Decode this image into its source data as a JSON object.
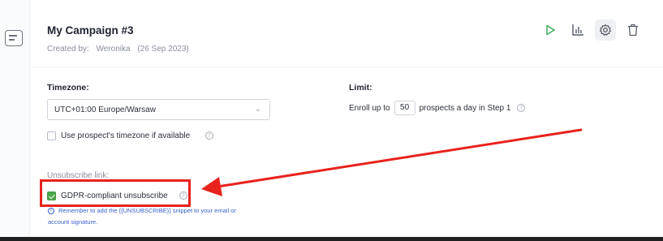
{
  "campaign": {
    "title": "My Campaign #3",
    "created_by_label": "Created by:",
    "created_by": "Weronika",
    "created_date": "(26 Sep 2023)"
  },
  "toolbar": {
    "icons": [
      "play-icon",
      "stats-icon",
      "settings-icon",
      "trash-icon"
    ],
    "accent_color": "#3fae5f"
  },
  "timezone": {
    "label": "Timezone:",
    "selected": "UTC+01:00 Europe/Warsaw",
    "use_prospect_label": "Use prospect's timezone if available",
    "use_prospect_checked": false
  },
  "limit": {
    "label": "Limit:",
    "prefix": "Enroll up to",
    "value": "50",
    "suffix": "prospects a day in Step 1"
  },
  "unsubscribe": {
    "label": "Unsubscribe link:",
    "gdpr_label": "GDPR-compliant unsubscribe",
    "gdpr_checked": true,
    "note_line1": "Remember to add the {{UNSUBSCRIBE}} snippet to your email or",
    "note_line2": "account signature."
  },
  "annotation": {
    "color": "#e8221d"
  }
}
